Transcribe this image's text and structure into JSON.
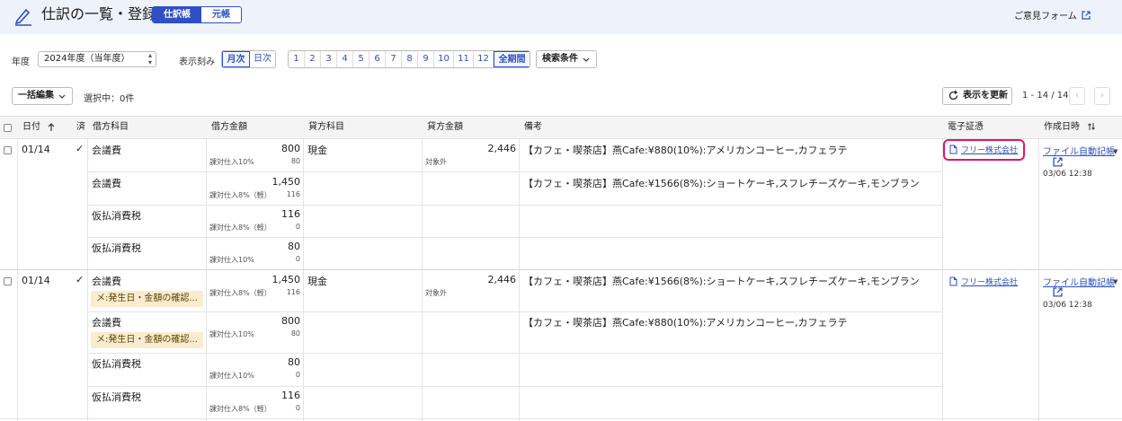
{
  "header": {
    "title": "仕訳の一覧・登録",
    "view_tabs": [
      "仕訳帳",
      "元帳"
    ],
    "feedback": "ご意見フォーム"
  },
  "filters": {
    "year_label": "年度",
    "year_value": "2024年度（当年度）",
    "scale_label": "表示刻み",
    "scale_options": [
      "月次",
      "日次"
    ],
    "months": [
      "1",
      "2",
      "3",
      "4",
      "5",
      "6",
      "7",
      "8",
      "9",
      "10",
      "11",
      "12"
    ],
    "all_period": "全期間",
    "search_conditions": "検索条件"
  },
  "toolbar": {
    "bulk_edit": "一括編集",
    "selected": "選択中：0件",
    "refresh": "表示を更新",
    "pager": "1 - 14 / 14"
  },
  "columns": {
    "date": "日付",
    "done": "済",
    "debit_account": "借方科目",
    "debit_amount": "借方金額",
    "credit_account": "貸方科目",
    "credit_amount": "貸方金額",
    "memo": "備考",
    "evidence": "電子証憑",
    "created": "作成日時"
  },
  "entries": [
    {
      "date": "01/14",
      "done": "✓",
      "credit_account": "現金",
      "credit_amount": "2,446",
      "credit_tax": "対象外",
      "evidence": "フリー株式会社",
      "created_by": "ファイル自動記帳",
      "created_at": "03/06 12:38",
      "lines": [
        {
          "account": "会議費",
          "amount": "800",
          "tax_class": "課対仕入10%",
          "tax": "80",
          "memo": "【カフェ・喫茶店】燕Cafe:¥880(10%):アメリカンコーヒー,カフェラテ"
        },
        {
          "account": "会議費",
          "amount": "1,450",
          "tax_class": "課対仕入8%（軽）",
          "tax": "116",
          "memo": "【カフェ・喫茶店】燕Cafe:¥1566(8%):ショートケーキ,スフレチーズケーキ,モンブラン"
        },
        {
          "account": "仮払消費税",
          "amount": "116",
          "tax_class": "課対仕入8%（軽）",
          "tax": "0"
        },
        {
          "account": "仮払消費税",
          "amount": "80",
          "tax_class": "課対仕入10%",
          "tax": "0"
        }
      ]
    },
    {
      "date": "01/14",
      "done": "✓",
      "credit_account": "現金",
      "credit_amount": "2,446",
      "credit_tax": "対象外",
      "evidence": "フリー株式会社",
      "created_by": "ファイル自動記帳",
      "created_at": "03/06 12:38",
      "lines": [
        {
          "account": "会議費",
          "tag": "メ:発生日・金額の確認...",
          "amount": "1,450",
          "tax_class": "課対仕入8%（軽）",
          "tax": "116",
          "memo": "【カフェ・喫茶店】燕Cafe:¥1566(8%):ショートケーキ,スフレチーズケーキ,モンブラン"
        },
        {
          "account": "会議費",
          "tag": "メ:発生日・金額の確認...",
          "amount": "800",
          "tax_class": "課対仕入10%",
          "tax": "80",
          "memo": "【カフェ・喫茶店】燕Cafe:¥880(10%):アメリカンコーヒー,カフェラテ"
        },
        {
          "account": "仮払消費税",
          "amount": "80",
          "tax_class": "課対仕入10%",
          "tax": "0"
        },
        {
          "account": "仮払消費税",
          "amount": "116",
          "tax_class": "課対仕入8%（軽）",
          "tax": "0"
        }
      ]
    }
  ]
}
